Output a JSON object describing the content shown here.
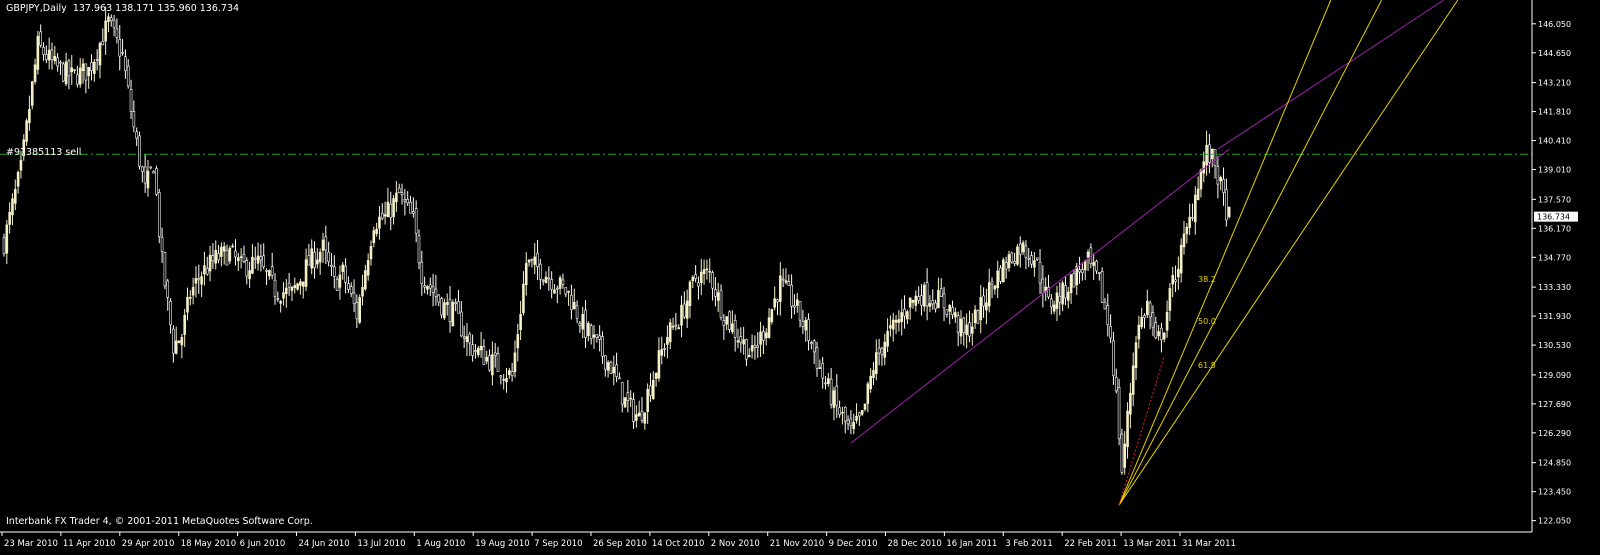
{
  "header": {
    "symbol": "GBPJPY,Daily",
    "ohlc": "137.963 138.171 135.960 136.734"
  },
  "footer": {
    "copyright": "Interbank FX Trader 4, © 2001-2011 MetaQuotes Software Corp."
  },
  "order_line": {
    "label": "#97385113 sell",
    "price": 139.75
  },
  "colors": {
    "background": "#000000",
    "bull_candle": "#f5f0c8",
    "bear_candle": "#ffffff",
    "order_line": "#1fa51f",
    "fan_lines": "#e6d200",
    "trend_line": "#a020b0",
    "dashed_line": "#e02020",
    "axis": "#ffffff"
  },
  "chart_data": {
    "type": "candlestick",
    "ylim": [
      121.5,
      147.2
    ],
    "y_ticks": [
      "146.050",
      "144.650",
      "143.210",
      "141.810",
      "140.410",
      "139.010",
      "137.570",
      "136.170",
      "134.770",
      "133.330",
      "131.930",
      "130.530",
      "129.090",
      "127.690",
      "126.290",
      "124.850",
      "123.450",
      "122.050"
    ],
    "x_labels": [
      "23 Mar 2010",
      "11 Apr 2010",
      "29 Apr 2010",
      "18 May 2010",
      "6 Jun 2010",
      "24 Jun 2010",
      "13 Jul 2010",
      "1 Aug 2010",
      "19 Aug 2010",
      "7 Sep 2010",
      "26 Sep 2010",
      "14 Oct 2010",
      "2 Nov 2010",
      "21 Nov 2010",
      "9 Dec 2010",
      "28 Dec 2010",
      "16 Jan 2011",
      "3 Feb 2011",
      "22 Feb 2011",
      "13 Mar 2011",
      "31 Mar 2011"
    ],
    "current_price": "136.734",
    "fib_labels": [
      "38.2",
      "50.0",
      "61.8"
    ],
    "close_path": [
      [
        0,
        135.5
      ],
      [
        6,
        139.0
      ],
      [
        12,
        145.0
      ],
      [
        18,
        144.0
      ],
      [
        24,
        143.5
      ],
      [
        30,
        143.8
      ],
      [
        37,
        146.1
      ],
      [
        42,
        144.5
      ],
      [
        46,
        141.0
      ],
      [
        50,
        138.0
      ],
      [
        53,
        139.3
      ],
      [
        56,
        134.5
      ],
      [
        60,
        130.5
      ],
      [
        63,
        131.0
      ],
      [
        66,
        133.0
      ],
      [
        70,
        134.0
      ],
      [
        75,
        134.7
      ],
      [
        80,
        135.0
      ],
      [
        84,
        134.3
      ],
      [
        90,
        134.5
      ],
      [
        96,
        133.2
      ],
      [
        102,
        133.0
      ],
      [
        108,
        134.5
      ],
      [
        113,
        135.2
      ],
      [
        117,
        133.5
      ],
      [
        120,
        134.0
      ],
      [
        125,
        132.0
      ],
      [
        131,
        136.5
      ],
      [
        135,
        136.7
      ],
      [
        140,
        137.8
      ],
      [
        145,
        136.5
      ],
      [
        148,
        134.0
      ],
      [
        155,
        132.5
      ],
      [
        160,
        132.0
      ],
      [
        165,
        130.5
      ],
      [
        170,
        130.0
      ],
      [
        175,
        129.5
      ],
      [
        180,
        129.0
      ],
      [
        185,
        134.5
      ],
      [
        190,
        134.2
      ],
      [
        195,
        133.6
      ],
      [
        200,
        133.0
      ],
      [
        205,
        131.5
      ],
      [
        210,
        130.5
      ],
      [
        215,
        129.5
      ],
      [
        220,
        127.8
      ],
      [
        225,
        127.0
      ],
      [
        230,
        129.0
      ],
      [
        235,
        131.0
      ],
      [
        240,
        132.0
      ],
      [
        245,
        133.8
      ],
      [
        250,
        134.0
      ],
      [
        255,
        132.0
      ],
      [
        260,
        131.0
      ],
      [
        265,
        130.0
      ],
      [
        270,
        131.5
      ],
      [
        275,
        133.5
      ],
      [
        280,
        132.5
      ],
      [
        285,
        131.0
      ],
      [
        290,
        129.0
      ],
      [
        295,
        127.5
      ],
      [
        300,
        126.3
      ],
      [
        304,
        127.0
      ],
      [
        308,
        129.5
      ],
      [
        312,
        130.8
      ],
      [
        316,
        131.5
      ],
      [
        320,
        132.5
      ],
      [
        325,
        133.0
      ],
      [
        330,
        132.8
      ],
      [
        335,
        132.3
      ],
      [
        340,
        131.0
      ],
      [
        345,
        132.0
      ],
      [
        350,
        133.5
      ],
      [
        355,
        134.5
      ],
      [
        360,
        135.3
      ],
      [
        365,
        134.8
      ],
      [
        370,
        132.5
      ],
      [
        375,
        133.0
      ],
      [
        380,
        134.0
      ],
      [
        384,
        134.5
      ],
      [
        388,
        133.5
      ],
      [
        392,
        131.0
      ],
      [
        394,
        128.0
      ],
      [
        396,
        124.5
      ],
      [
        398,
        127.0
      ],
      [
        401,
        131.0
      ],
      [
        405,
        132.5
      ],
      [
        408,
        130.5
      ],
      [
        411,
        131.5
      ],
      [
        414,
        133.5
      ],
      [
        417,
        135.0
      ],
      [
        420,
        136.5
      ],
      [
        423,
        138.5
      ],
      [
        426,
        139.8
      ],
      [
        429,
        139.3
      ],
      [
        432,
        137.5
      ],
      [
        434,
        136.7
      ]
    ],
    "annotations": {
      "green_order_line_price": 139.75,
      "magenta_trend": {
        "from": [
          300,
          125.8
        ],
        "to": [
          434,
          140.0
        ]
      },
      "magenta_channel": {
        "from": [
          430,
          140.0
        ],
        "to": [
          510,
          147.2
        ]
      },
      "fan_origin": [
        395,
        122.8
      ],
      "fan_targets": [
        [
          470,
          147.2
        ],
        [
          488,
          147.2
        ],
        [
          515,
          147.2
        ]
      ],
      "red_dashed": {
        "from": [
          395,
          122.8
        ],
        "to": [
          411,
          130.0
        ]
      }
    }
  }
}
